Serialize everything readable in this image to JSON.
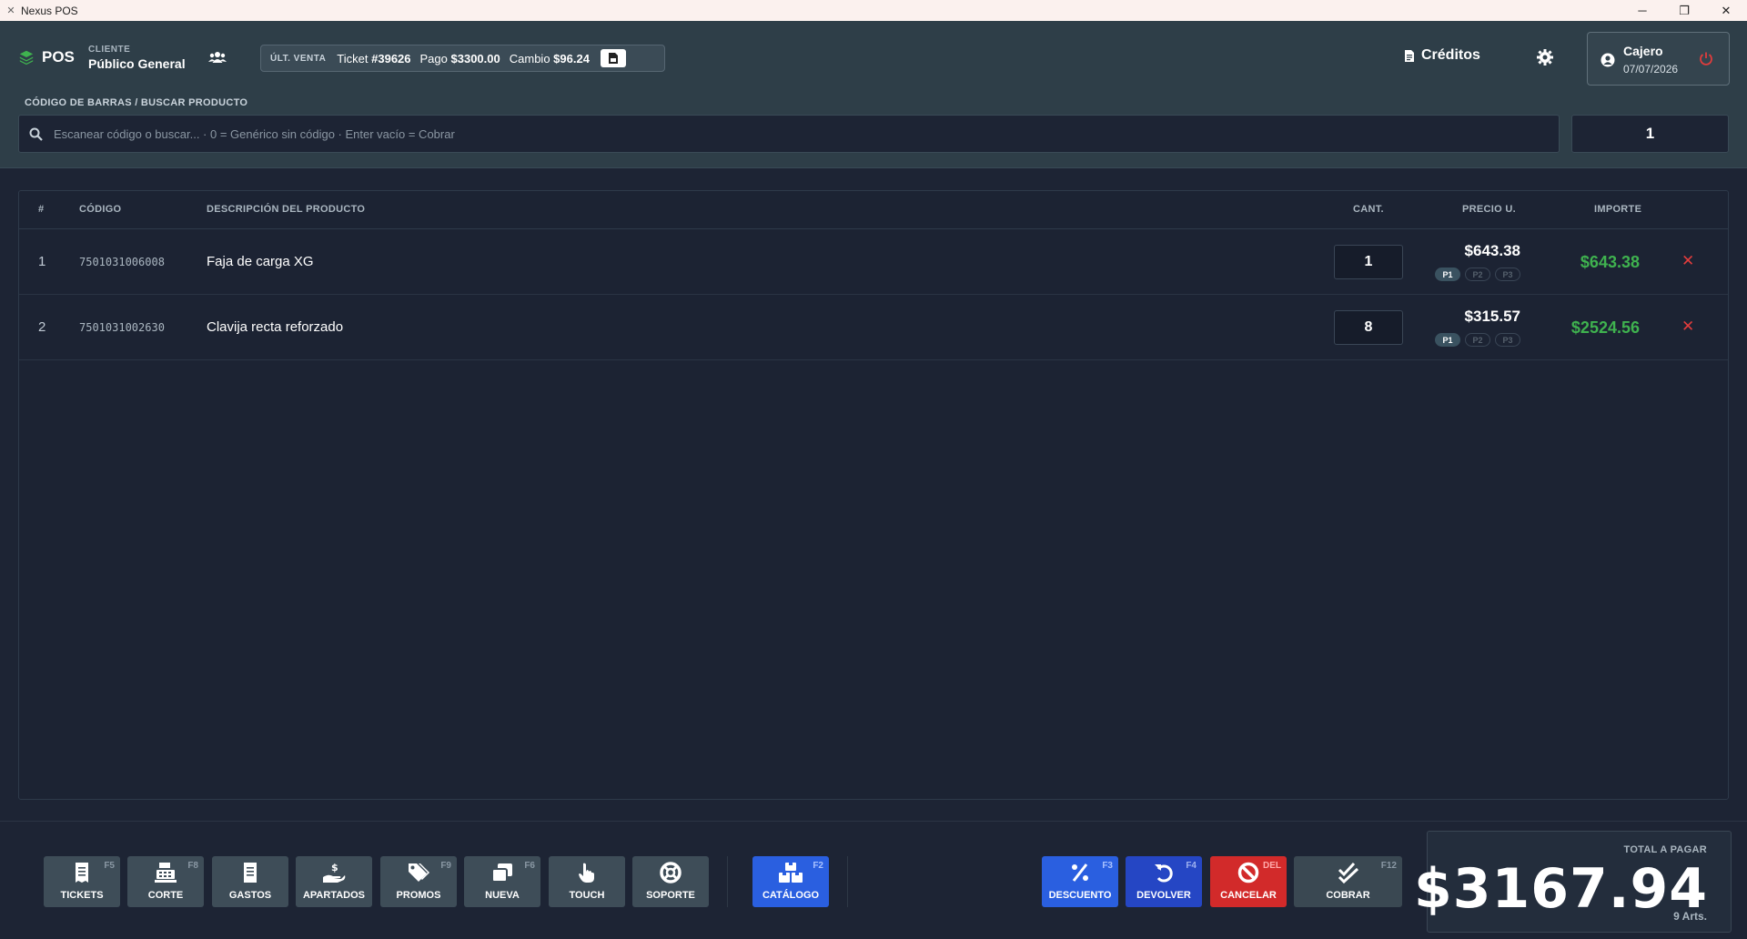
{
  "window": {
    "title": "Nexus POS"
  },
  "header": {
    "brand": "POS",
    "client_label": "CLIENTE",
    "client_name": "Público General",
    "last_sale": {
      "tag": "ÚLT. VENTA",
      "ticket_label": "Ticket",
      "ticket_number": "#39626",
      "payment_label": "Pago",
      "payment": "$3300.00",
      "change_label": "Cambio",
      "change": "$96.24"
    },
    "credits_label": "Créditos",
    "cashier_name": "Cajero",
    "cashier_date": "07/07/2026"
  },
  "search": {
    "label": "CÓDIGO DE BARRAS / BUSCAR PRODUCTO",
    "placeholder": "Escanear código o buscar... · 0 = Genérico sin código · Enter vacío = Cobrar",
    "quantity": "1"
  },
  "table": {
    "headers": {
      "index": "#",
      "code": "CÓDIGO",
      "description": "DESCRIPCIÓN DEL PRODUCTO",
      "qty": "CANT.",
      "unit_price": "PRECIO U.",
      "amount": "IMPORTE"
    },
    "rows": [
      {
        "index": "1",
        "code": "7501031006008",
        "description": "Faja de carga XG",
        "qty": "1",
        "unit_price": "$643.38",
        "levels": [
          "P1",
          "P2",
          "P3"
        ],
        "active_level": "P1",
        "amount": "$643.38"
      },
      {
        "index": "2",
        "code": "7501031002630",
        "description": "Clavija recta reforzado",
        "qty": "8",
        "unit_price": "$315.57",
        "levels": [
          "P1",
          "P2",
          "P3"
        ],
        "active_level": "P1",
        "amount": "$2524.56"
      }
    ]
  },
  "footer": {
    "buttons": [
      {
        "label": "TICKETS",
        "key": "F5",
        "icon": "receipt-icon"
      },
      {
        "label": "CORTE",
        "key": "F8",
        "icon": "cash-register-icon"
      },
      {
        "label": "GASTOS",
        "key": "",
        "icon": "document-icon"
      },
      {
        "label": "APARTADOS",
        "key": "",
        "icon": "hand-dollar-icon"
      },
      {
        "label": "PROMOS",
        "key": "F9",
        "icon": "tags-icon"
      },
      {
        "label": "NUEVA",
        "key": "F6",
        "icon": "windows-icon"
      },
      {
        "label": "TOUCH",
        "key": "",
        "icon": "touch-icon"
      },
      {
        "label": "SOPORTE",
        "key": "",
        "icon": "lifebuoy-icon"
      },
      {
        "label": "CATÁLOGO",
        "key": "F2",
        "icon": "boxes-icon"
      },
      {
        "label": "DESCUENTO",
        "key": "F3",
        "icon": "percent-icon"
      },
      {
        "label": "DEVOLVER",
        "key": "F4",
        "icon": "undo-icon"
      },
      {
        "label": "CANCELAR",
        "key": "DEL",
        "icon": "ban-icon"
      },
      {
        "label": "COBRAR",
        "key": "F12",
        "icon": "checks-icon"
      }
    ],
    "total_label": "TOTAL A PAGAR",
    "total": "$3167.94",
    "items_count": "9 Arts."
  },
  "colors": {
    "header_bg": "#2e3e48",
    "body_bg": "#1d2434",
    "amount_green": "#3fb24f",
    "delete_red": "#e23c3c",
    "catalog_blue": "#2a5fe0",
    "return_navy": "#2546c4",
    "cancel_red": "#d22a2a"
  }
}
